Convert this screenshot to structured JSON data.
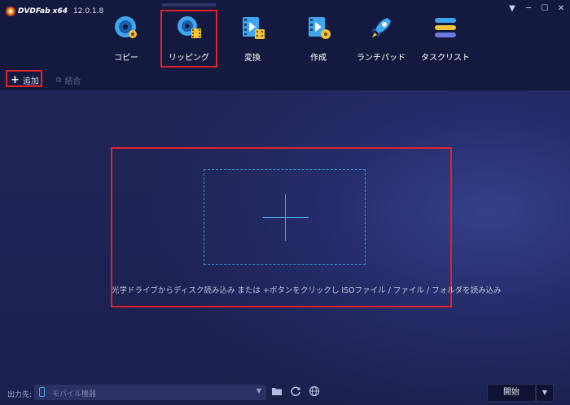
{
  "app": {
    "name": "DVDFab x64",
    "version": "12.0.1.8"
  },
  "window_controls": [
    "▼",
    "─",
    "☐",
    "✕"
  ],
  "modules": [
    {
      "label": "コピー",
      "icon": "copy-disc-icon"
    },
    {
      "label": "リッピング",
      "icon": "ripper-disc-icon"
    },
    {
      "label": "変換",
      "icon": "converter-film-icon"
    },
    {
      "label": "作成",
      "icon": "creator-film-icon"
    },
    {
      "label": "ランチパッド",
      "icon": "launchpad-rocket-icon"
    },
    {
      "label": "タスクリスト",
      "icon": "tasklist-bars-icon"
    }
  ],
  "toolbar": {
    "add_label": "追加",
    "merge_label": "結合"
  },
  "drop_zone": {
    "hint": "光学ドライブからディスク読み込み または +ボタンをクリックし ISOファイル / ファイル / フォルダを読み込み"
  },
  "bottom": {
    "output_label": "出力先:",
    "output_value": "モバイル機器",
    "start_label": "開始"
  },
  "colors": {
    "highlight": "#e0232b",
    "accent": "#49a6e9",
    "topbar": "#141a3f"
  }
}
